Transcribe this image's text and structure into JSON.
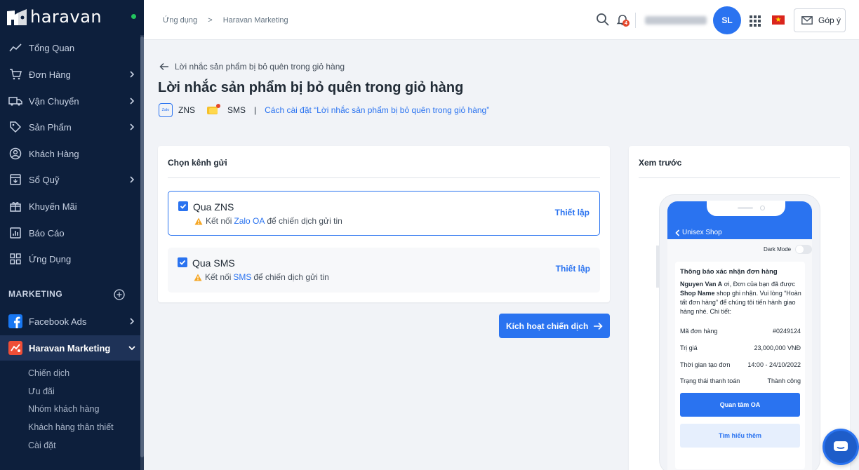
{
  "sidebar": {
    "logo_text": "haravan",
    "items": [
      {
        "label": "Tổng Quan",
        "icon": "chart-line-icon",
        "has_chevron": false
      },
      {
        "label": "Đơn Hàng",
        "icon": "cart-icon",
        "has_chevron": true
      },
      {
        "label": "Vận Chuyển",
        "icon": "truck-icon",
        "has_chevron": true
      },
      {
        "label": "Sản Phẩm",
        "icon": "tag-icon",
        "has_chevron": true
      },
      {
        "label": "Khách Hàng",
        "icon": "user-circle-icon",
        "has_chevron": false
      },
      {
        "label": "Sổ Quỹ",
        "icon": "ledger-icon",
        "has_chevron": true
      },
      {
        "label": "Khuyến Mãi",
        "icon": "gift-icon",
        "has_chevron": false
      },
      {
        "label": "Báo Cáo",
        "icon": "report-icon",
        "has_chevron": false
      },
      {
        "label": "Ứng Dụng",
        "icon": "apps-icon",
        "has_chevron": false
      }
    ],
    "section_label": "MARKETING",
    "marketing_items": [
      {
        "label": "Facebook Ads",
        "icon": "facebook-icon"
      },
      {
        "label": "Haravan Marketing",
        "icon": "haravan-marketing-icon"
      }
    ],
    "sub_items": [
      "Chiến dịch",
      "Ưu đãi",
      "Nhóm khách hàng",
      "Khách hàng thân thiết",
      "Cài đặt"
    ]
  },
  "topbar": {
    "breadcrumb": [
      "Ứng dụng",
      "Haravan Marketing"
    ],
    "breadcrumb_sep": ">",
    "notification_count": "4",
    "avatar_initials": "SL",
    "feedback_label": "Góp ý"
  },
  "page": {
    "back_label": "Lời nhắc sản phẩm bị bỏ quên trong giỏ hàng",
    "title": "Lời nhắc sản phẩm bị bỏ quên trong giỏ hàng",
    "zalo_logo_text": "Zalo",
    "zns_label": "ZNS",
    "sms_label": "SMS",
    "separator": "|",
    "howto_link": "Cách cài đặt “Lời nhắc sản phẩm bị bỏ quên trong giỏ hàng”"
  },
  "channel_card": {
    "title": "Chọn kênh gửi",
    "options": [
      {
        "title": "Qua ZNS",
        "warn_prefix": "Kết nối",
        "warn_link": "Zalo OA",
        "warn_suffix": "để chiến dịch gửi tin",
        "setup_label": "Thiết lập",
        "checked": true
      },
      {
        "title": "Qua SMS",
        "warn_prefix": "Kết nối",
        "warn_link": "SMS",
        "warn_suffix": "để chiến dịch gửi tin",
        "setup_label": "Thiết lập",
        "checked": true
      }
    ],
    "activate_label": "Kích hoạt chiến dịch"
  },
  "preview": {
    "title": "Xem trước",
    "shop_name": "Unisex Shop",
    "dark_mode_label": "Dark Mode",
    "msg_title": "Thông báo xác nhận đơn hàng",
    "msg_customer": "Nguyen Van A",
    "msg_text1": " ơi, Đơn của bạn đã được ",
    "msg_shop": "Shop Name",
    "msg_text2": " shop ghi nhận. Vui lòng “Hoàn tất đơn hàng” để chúng tôi tiến hành giao hàng nhé. Chi tiết:",
    "rows": [
      {
        "label": "Mã đơn hàng",
        "value": "#0249124"
      },
      {
        "label": "Trị giá",
        "value": "23,000,000 VNĐ"
      },
      {
        "label": "Thời gian tạo đơn",
        "value": "14:00 - 24/10/2022"
      },
      {
        "label": "Trạng thái thanh toán",
        "value": "Thành công"
      }
    ],
    "btn_primary": "Quan tâm OA",
    "btn_secondary": "Tìm hiểu thêm"
  },
  "colors": {
    "sidebar_bg": "#0d1f3c",
    "accent": "#2a73f0",
    "warning": "#f5a623",
    "badge": "#e5482c",
    "online": "#22c55e"
  }
}
